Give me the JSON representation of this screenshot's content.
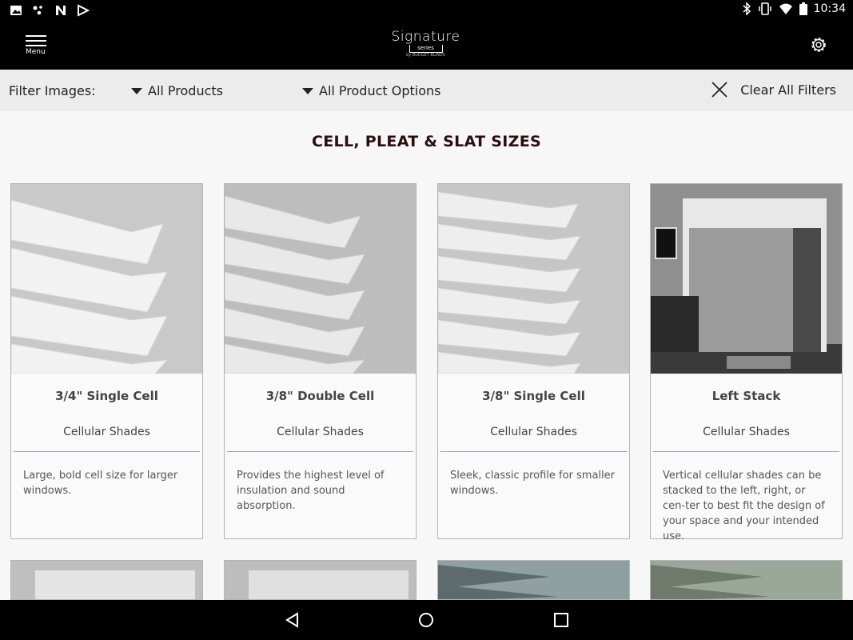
{
  "status": {
    "time": "10:34",
    "left_icons": [
      "image-icon",
      "dots-icon",
      "n-icon",
      "play-store-icon"
    ],
    "right_icons": [
      "bluetooth-icon",
      "vibrate-icon",
      "wifi-icon",
      "battery-icon"
    ]
  },
  "appbar": {
    "menu_label": "Menu",
    "logo_main": "Signature",
    "logo_sub": "series",
    "logo_by": "by BUDGET BLINDS"
  },
  "filter": {
    "label": "Filter Images:",
    "products_selected": "All Products",
    "options_selected": "All Product Options",
    "clear_label": "Clear All Filters"
  },
  "section": {
    "title": "CELL, PLEAT & SLAT SIZES"
  },
  "cards": [
    {
      "title": "3/4\" Single Cell",
      "category": "Cellular Shades",
      "description": "Large, bold cell size for larger windows."
    },
    {
      "title": "3/8\" Double Cell",
      "category": "Cellular Shades",
      "description": "Provides the highest level of insulation and sound absorption."
    },
    {
      "title": "3/8\" Single Cell",
      "category": "Cellular Shades",
      "description": "Sleek, classic profile for smaller windows."
    },
    {
      "title": "Left Stack",
      "category": "Cellular Shades",
      "description": "Vertical cellular shades can be stacked to the left, right, or cen-ter to best fit the design of your space and your intended use."
    }
  ],
  "colors": {
    "accent_rule": "#9abd2b",
    "title_color": "#2b0e0e"
  }
}
